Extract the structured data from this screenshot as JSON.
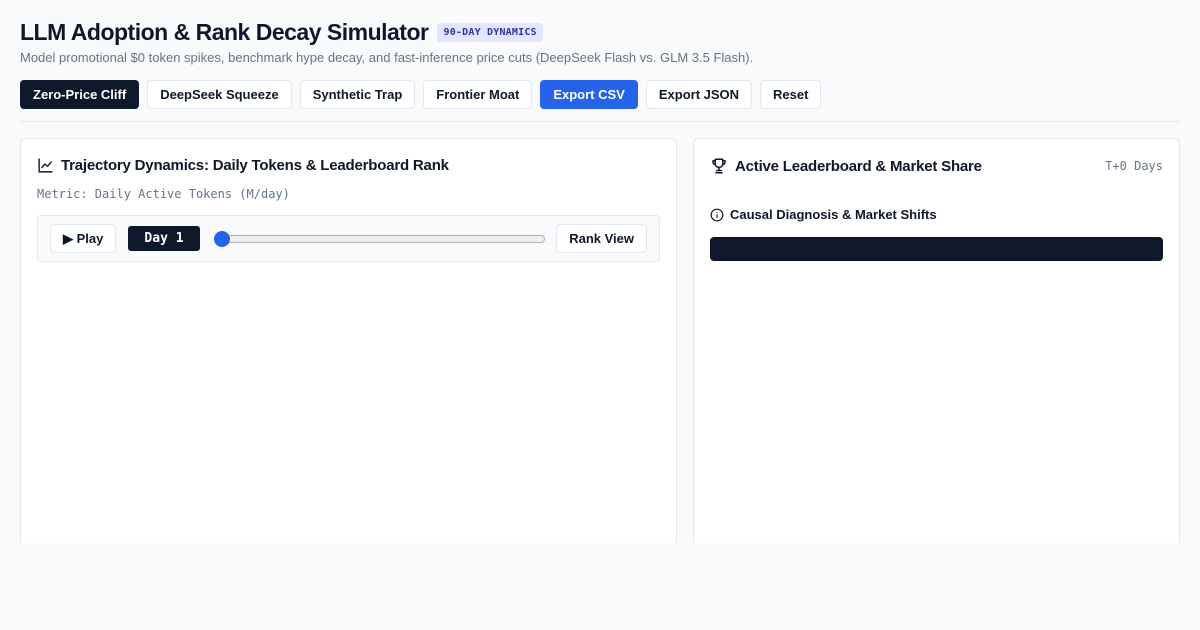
{
  "header": {
    "title": "LLM Adoption & Rank Decay Simulator",
    "badge": "90-DAY DYNAMICS",
    "subtitle": "Model promotional $0 token spikes, benchmark hype decay, and fast-inference price cuts (DeepSeek Flash vs. GLM 3.5 Flash)."
  },
  "toolbar": {
    "buttons": [
      {
        "label": "Zero-Price Cliff",
        "style": "active"
      },
      {
        "label": "DeepSeek Squeeze",
        "style": "default"
      },
      {
        "label": "Synthetic Trap",
        "style": "default"
      },
      {
        "label": "Frontier Moat",
        "style": "default"
      },
      {
        "label": "Export CSV",
        "style": "primary"
      },
      {
        "label": "Export JSON",
        "style": "default"
      },
      {
        "label": "Reset",
        "style": "default"
      }
    ]
  },
  "trajectory_panel": {
    "title": "Trajectory Dynamics: Daily Tokens & Leaderboard Rank",
    "metric_label": "Metric: Daily Active Tokens (M/day)",
    "icon": "line-chart-icon",
    "play_label": "▶ Play",
    "day_label": "Day 1",
    "slider": {
      "min": 1,
      "max": 90,
      "value": 1
    },
    "view_toggle_label": "Rank View"
  },
  "leaderboard_panel": {
    "title": "Active Leaderboard & Market Share",
    "icon": "trophy-icon",
    "time_label": "T+0 Days",
    "diagnosis_title": "Causal Diagnosis & Market Shifts",
    "diagnosis_icon": "info-icon"
  },
  "colors": {
    "primary": "#2563eb",
    "dark": "#0f172a",
    "badge_bg": "#e0e7ff",
    "badge_text": "#3730a3",
    "muted_text": "#64748b",
    "border": "#e2e8f0"
  }
}
